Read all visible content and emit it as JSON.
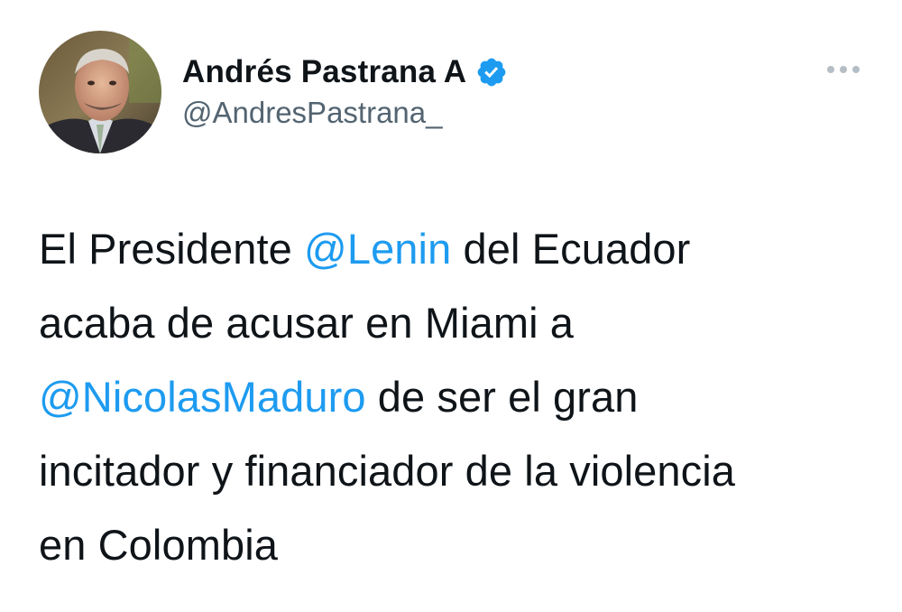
{
  "tweet": {
    "author": {
      "display_name": "Andrés Pastrana A",
      "handle": "@AndresPastrana_",
      "verified": true,
      "avatar_icon": "avatar-photo"
    },
    "more_icon": "more-horizontal-icon",
    "text_lines": [
      {
        "before": "El Presidente ",
        "mention": "@Lenin",
        "after": " del Ecuador"
      },
      {
        "text": "acaba de acusar en Miami a"
      },
      {
        "mention": "@NicolasMaduro",
        "after": " de ser el gran"
      },
      {
        "text": "incitador y financiador de la violencia"
      },
      {
        "text": "en Colombia"
      }
    ]
  },
  "colors": {
    "text": "#0f1419",
    "secondary": "#536471",
    "mention": "#1d9bf0",
    "verified_badge": "#1d9bf0",
    "background": "#ffffff"
  }
}
